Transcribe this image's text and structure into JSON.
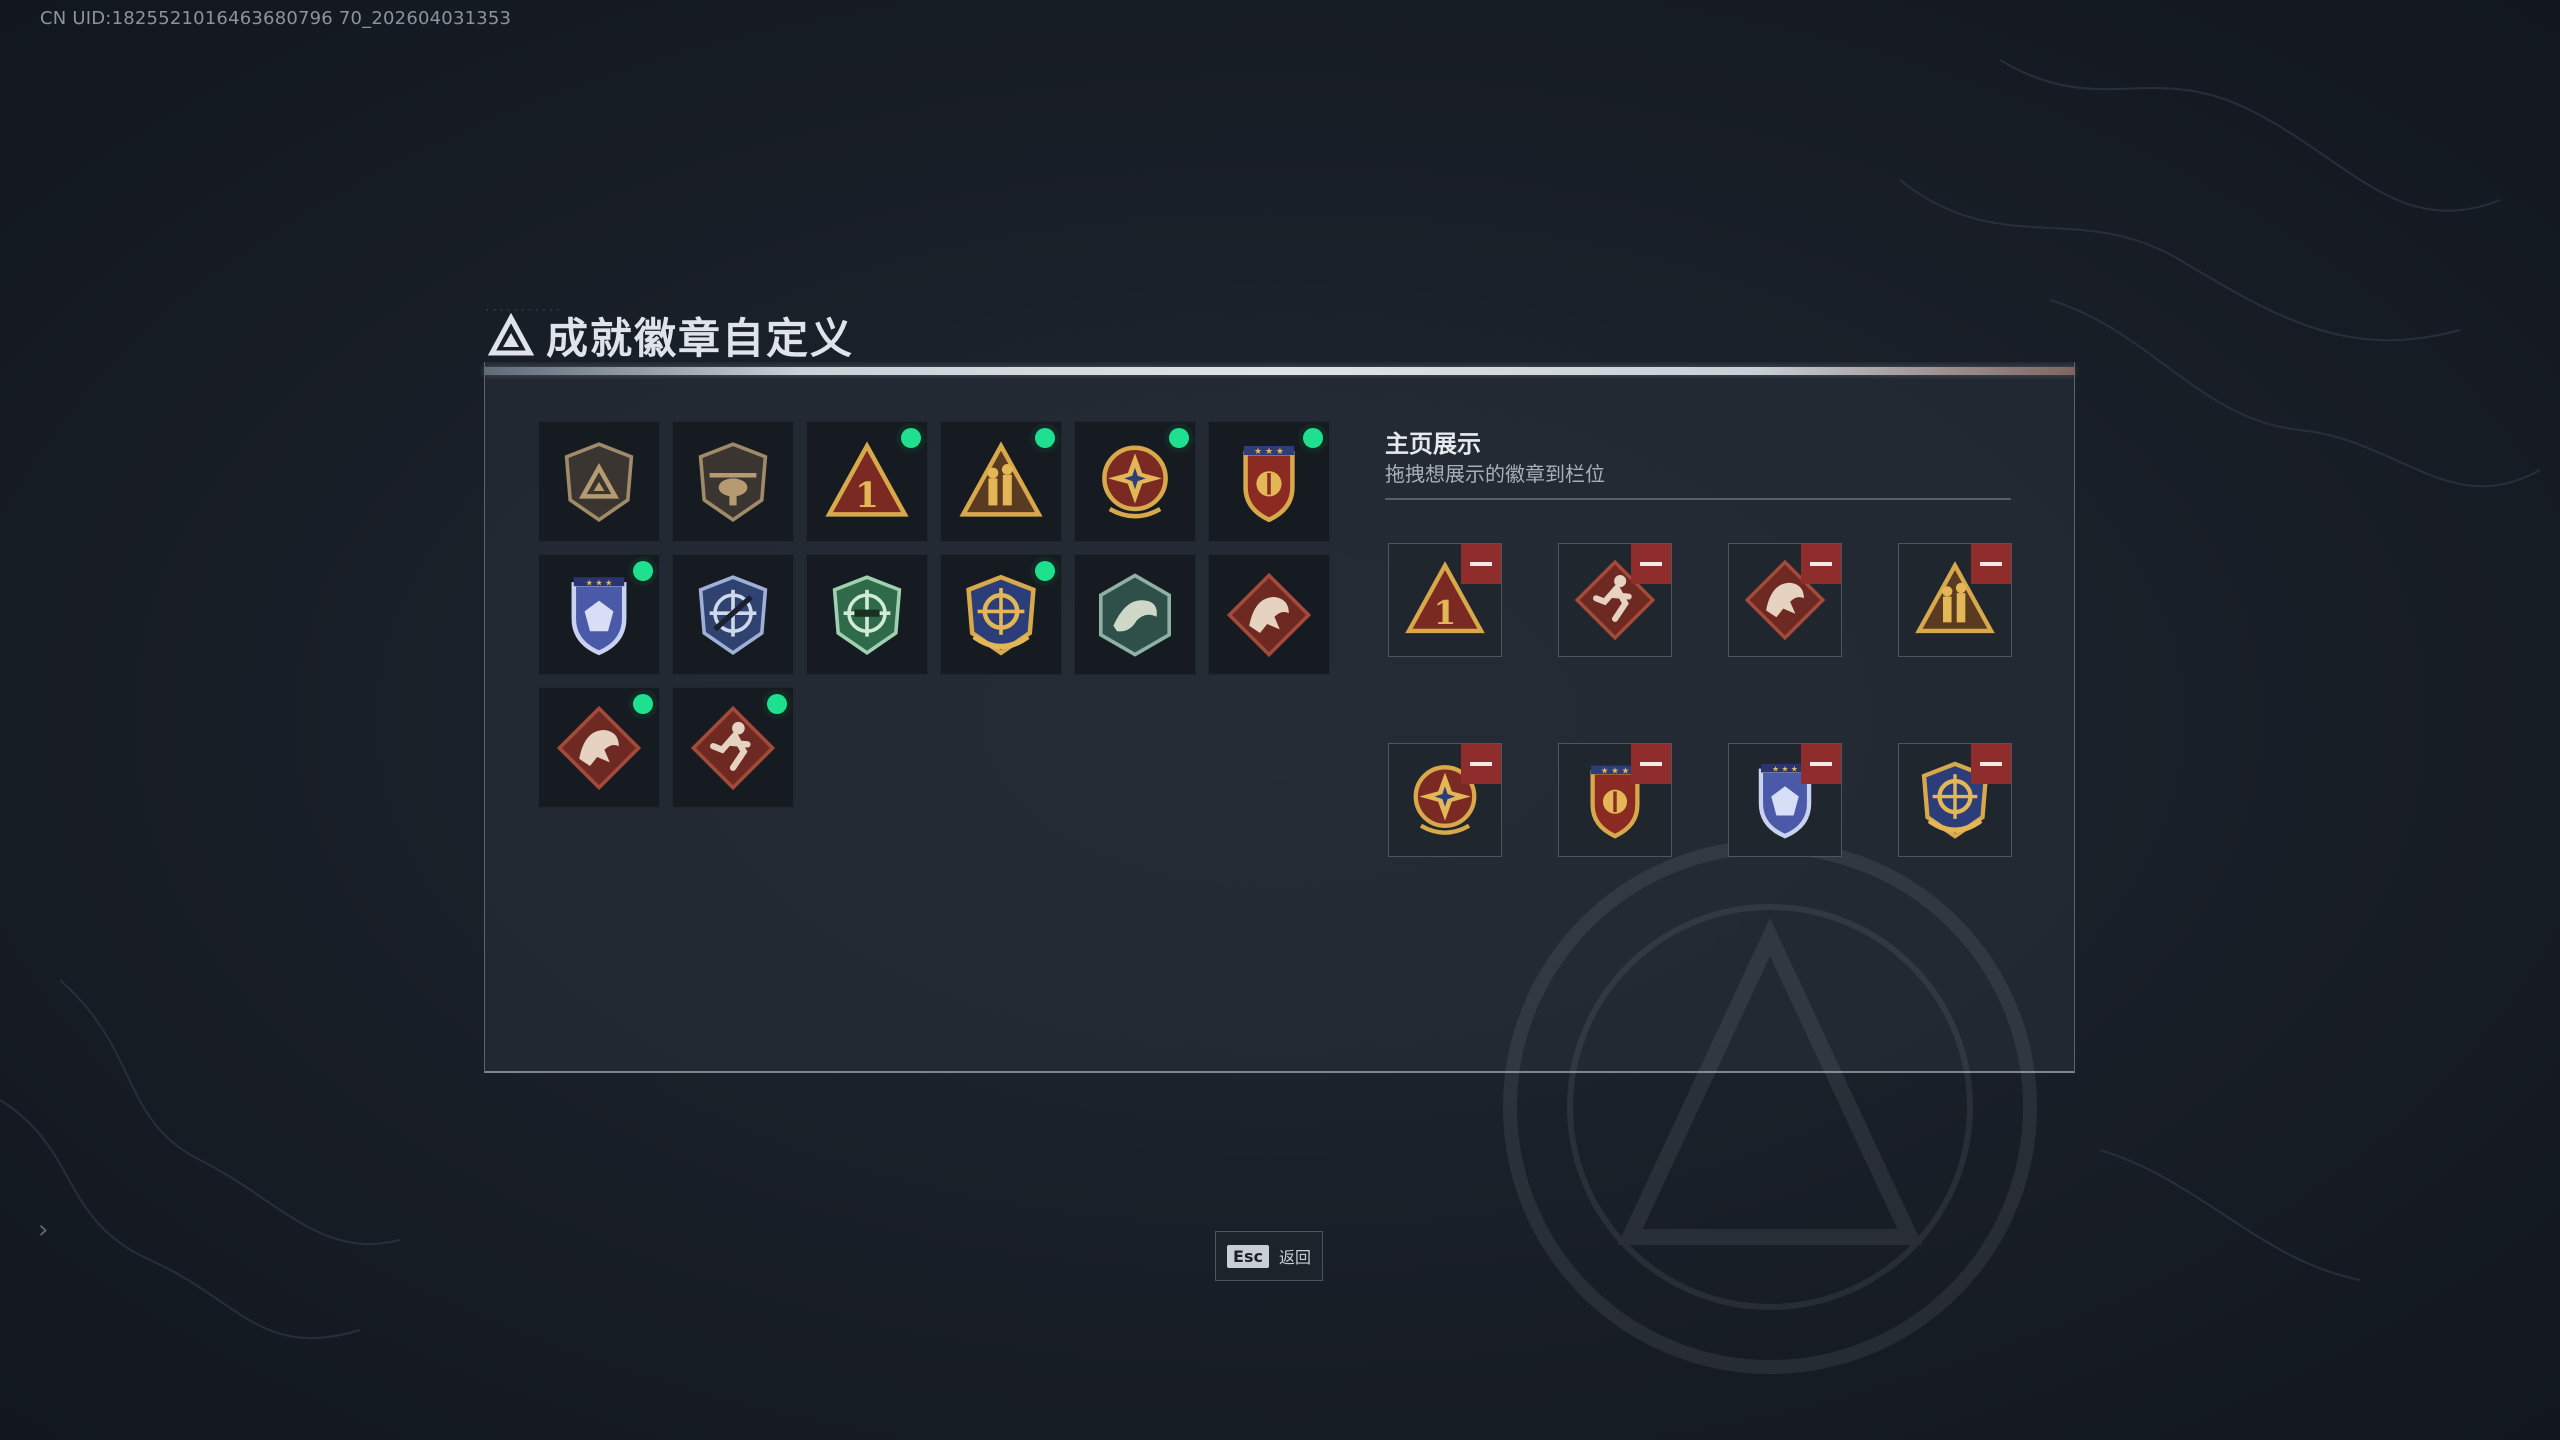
{
  "uid_text": "CN UID:1825521016463680796 70_202604031353",
  "title": "成就徽章自定义",
  "showcase": {
    "title": "主页展示",
    "subtitle": "拖拽想展示的徽章到栏位"
  },
  "badges": [
    {
      "icon": "shield-triangle-bronze-icon",
      "selected": false
    },
    {
      "icon": "shield-helicopter-bronze-icon",
      "selected": false
    },
    {
      "icon": "triangle-number-one-icon",
      "selected": true
    },
    {
      "icon": "triangle-soldiers-icon",
      "selected": true
    },
    {
      "icon": "compass-star-medal-icon",
      "selected": true
    },
    {
      "icon": "crest-stars-shield-icon",
      "selected": true
    },
    {
      "icon": "blue-shield-stars-icon",
      "selected": true
    },
    {
      "icon": "blue-crosshair-shield-icon",
      "selected": false
    },
    {
      "icon": "green-crosshair-shield-icon",
      "selected": false
    },
    {
      "icon": "gold-crosshair-laurel-icon",
      "selected": true
    },
    {
      "icon": "hexagon-dragon-icon",
      "selected": false
    },
    {
      "icon": "red-diamond-dragon-icon",
      "selected": false
    },
    {
      "icon": "red-diamond-dragon-icon",
      "selected": true
    },
    {
      "icon": "red-diamond-runner-icon",
      "selected": true
    }
  ],
  "slots": [
    {
      "icon": "triangle-number-one-icon"
    },
    {
      "icon": "red-diamond-runner-icon"
    },
    {
      "icon": "red-diamond-dragon-icon"
    },
    {
      "icon": "triangle-soldiers-icon"
    },
    {
      "icon": "compass-star-medal-icon"
    },
    {
      "icon": "crest-stars-shield-icon"
    },
    {
      "icon": "blue-shield-stars-icon"
    },
    {
      "icon": "gold-crosshair-laurel-icon"
    }
  ],
  "esc": {
    "key": "Esc",
    "label": "返回"
  },
  "colors": {
    "selected_dot": "#1ee08f",
    "remove_button": "#8f2d2d",
    "panel_topbar": "#dfe4e9"
  }
}
